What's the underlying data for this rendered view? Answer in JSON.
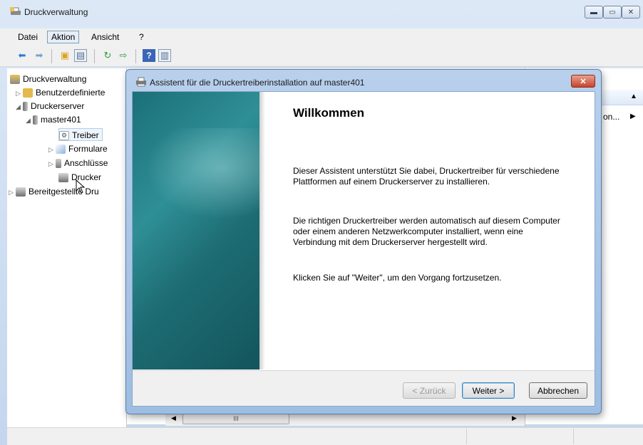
{
  "window": {
    "title": "Druckverwaltung",
    "controls": [
      "minimize",
      "maximize",
      "close"
    ]
  },
  "menubar": {
    "items": [
      "Datei",
      "Aktion",
      "Ansicht",
      "?"
    ],
    "active": "Aktion"
  },
  "toolbar": {
    "icons": [
      "back-arrow",
      "forward-arrow",
      "folder-up",
      "show-hide-tree",
      "refresh",
      "export-list",
      "help",
      "show-hide-action-pane"
    ]
  },
  "tree": {
    "root": "Druckverwaltung",
    "items": [
      {
        "label": "Benutzerdefinierte",
        "level": 1,
        "expander": "▷"
      },
      {
        "label": "Druckerserver",
        "level": 1,
        "expander": "◢"
      },
      {
        "label": "master401",
        "level": 2,
        "expander": "◢"
      },
      {
        "label": "Treiber",
        "level": 3,
        "expander": "",
        "selected": true
      },
      {
        "label": "Formulare",
        "level": 3,
        "expander": "▷"
      },
      {
        "label": "Anschlüsse",
        "level": 3,
        "expander": "▷"
      },
      {
        "label": "Drucker",
        "level": 3,
        "expander": ""
      },
      {
        "label": "Bereitgestellte Dru",
        "level": 1,
        "expander": "▷"
      }
    ]
  },
  "rightpane": {
    "scroll_up": "▲",
    "action_label": "on...",
    "action_arrow": "▶"
  },
  "scrollbar": {
    "left_arrow": "◀",
    "thumb": "III",
    "right_arrow": "▶"
  },
  "dialog": {
    "title": "Assistent für die Druckertreiberinstallation auf master401",
    "close": "✕",
    "heading": "Willkommen",
    "paragraph1": "Dieser Assistent unterstützt Sie dabei, Druckertreiber für verschiedene Plattformen auf einem Druckerserver zu installieren.",
    "paragraph2": "Die richtigen Druckertreiber werden automatisch auf diesem Computer oder einem anderen Netzwerkcomputer installiert, wenn eine Verbindung mit dem Druckerserver hergestellt wird.",
    "paragraph3": "Klicken Sie auf \"Weiter\", um den Vorgang fortzusetzen.",
    "buttons": {
      "back": "< Zurück",
      "next": "Weiter >",
      "cancel": "Abbrechen"
    }
  },
  "colors": {
    "banner": "#1b6f78",
    "close_button": "#c8442b",
    "titlebar": "#dce8f6"
  }
}
